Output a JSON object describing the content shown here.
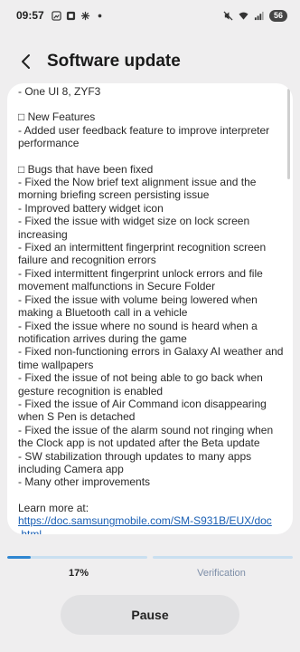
{
  "status_bar": {
    "time": "09:57",
    "battery": "56"
  },
  "header": {
    "title": "Software update"
  },
  "notes": {
    "lines": [
      "- One UI 8, ZYF3",
      "",
      "□ New Features",
      "- Added user feedback feature to improve interpreter",
      "performance",
      "",
      "□ Bugs that have been fixed",
      "- Fixed the Now brief text alignment issue and the",
      "morning briefing screen persisting issue",
      "- Improved battery widget icon",
      "- Fixed the issue with widget size on lock screen",
      "increasing",
      "- Fixed an intermittent fingerprint recognition screen",
      "failure and recognition errors",
      "- Fixed intermittent fingerprint unlock errors and file",
      "movement malfunctions in Secure Folder",
      "- Fixed the issue with volume being lowered when",
      "making a Bluetooth call in a vehicle",
      "- Fixed the issue where no sound is heard when a",
      "notification arrives during the game",
      "- Fixed non-functioning errors in Galaxy AI weather and",
      "time wallpapers",
      "- Fixed the issue of not being able to go back when",
      "gesture recognition is enabled",
      "- Fixed the issue of Air Command icon disappearing",
      "when S Pen is detached",
      "- Fixed the issue of the alarm sound not ringing when",
      "the Clock app is not updated after the Beta update",
      "- SW stabilization through updates to many apps",
      "including Camera app",
      "- Many other improvements",
      "",
      "Learn more at:"
    ],
    "link_line1": "https://doc.samsungmobile.com/SM-S931B/EUX/doc",
    "link_line2": ".html"
  },
  "progress": {
    "download_percent": 17,
    "download_label": "17%",
    "verification_label": "Verification",
    "accent": "#2f86d1",
    "track": "#c9dff0"
  },
  "actions": {
    "pause_label": "Pause"
  }
}
